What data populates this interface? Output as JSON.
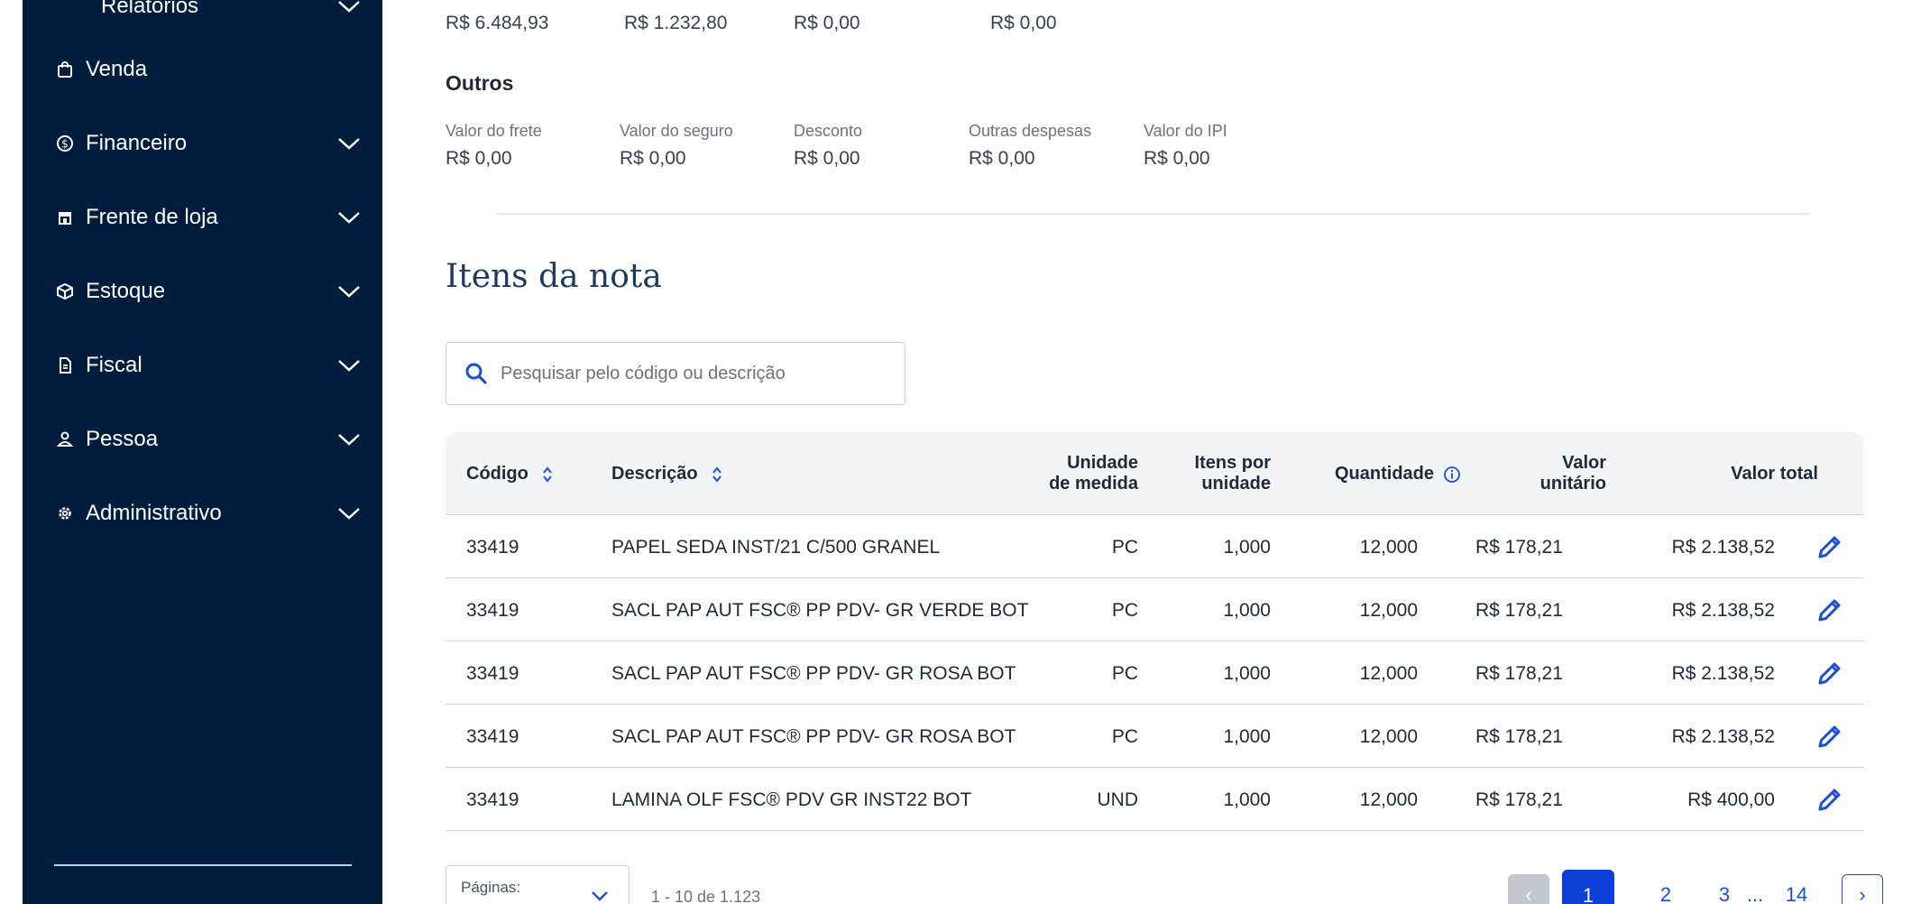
{
  "sidebar": {
    "items": [
      {
        "label": "Relatórios"
      },
      {
        "label": "Venda"
      },
      {
        "label": "Financeiro"
      },
      {
        "label": "Frente de loja"
      },
      {
        "label": "Estoque"
      },
      {
        "label": "Fiscal"
      },
      {
        "label": "Pessoa"
      },
      {
        "label": "Administrativo"
      }
    ]
  },
  "taxes": {
    "values": [
      "R$ 6.484,93",
      "R$ 1.232,80",
      "R$ 0,00",
      "R$ 0,00"
    ]
  },
  "outros": {
    "title": "Outros",
    "fields": [
      {
        "label": "Valor do frete",
        "value": "R$ 0,00"
      },
      {
        "label": "Valor do seguro",
        "value": "R$ 0,00"
      },
      {
        "label": "Desconto",
        "value": "R$ 0,00"
      },
      {
        "label": "Outras despesas",
        "value": "R$ 0,00"
      },
      {
        "label": "Valor do IPI",
        "value": "R$ 0,00"
      }
    ]
  },
  "items": {
    "title": "Itens da nota",
    "search_placeholder": "Pesquisar pelo código ou descrição",
    "columns": {
      "codigo": "Código",
      "descricao": "Descrição",
      "unidade_1": "Unidade",
      "unidade_2": "de medida",
      "itens_1": "Itens por",
      "itens_2": "unidade",
      "quantidade": "Quantidade",
      "valor_unit_1": "Valor",
      "valor_unit_2": "unitário",
      "valor_total": "Valor total"
    },
    "rows": [
      {
        "codigo": "33419",
        "descricao": "PAPEL SEDA INST/21 C/500 GRANEL",
        "unidade": "PC",
        "itens": "1,000",
        "quantidade": "12,000",
        "valor_unit": "R$ 178,21",
        "valor_total": "R$ 2.138,52"
      },
      {
        "codigo": "33419",
        "descricao": "SACL PAP AUT FSC® PP PDV- GR VERDE BOT",
        "unidade": "PC",
        "itens": "1,000",
        "quantidade": "12,000",
        "valor_unit": "R$ 178,21",
        "valor_total": "R$ 2.138,52"
      },
      {
        "codigo": "33419",
        "descricao": "SACL PAP AUT FSC® PP PDV- GR ROSA BOT",
        "unidade": "PC",
        "itens": "1,000",
        "quantidade": "12,000",
        "valor_unit": "R$ 178,21",
        "valor_total": "R$ 2.138,52"
      },
      {
        "codigo": "33419",
        "descricao": "SACL PAP AUT FSC® PP PDV- GR ROSA BOT",
        "unidade": "PC",
        "itens": "1,000",
        "quantidade": "12,000",
        "valor_unit": "R$ 178,21",
        "valor_total": "R$ 2.138,52"
      },
      {
        "codigo": "33419",
        "descricao": "LAMINA OLF FSC® PDV GR INST22 BOT",
        "unidade": "UND",
        "itens": "1,000",
        "quantidade": "12,000",
        "valor_unit": "R$ 178,21",
        "valor_total": "R$ 400,00"
      }
    ]
  },
  "pagination": {
    "per_page_label": "Páginas:",
    "range": "1 - 10 de 1.123",
    "pages": [
      "1",
      "2",
      "3",
      "...",
      "14"
    ],
    "prev": "‹",
    "next": "›"
  },
  "colors": {
    "sidebar_bg": "#011d3d",
    "accent": "#0b3fd6",
    "edit_icon": "#1d4ed8"
  }
}
